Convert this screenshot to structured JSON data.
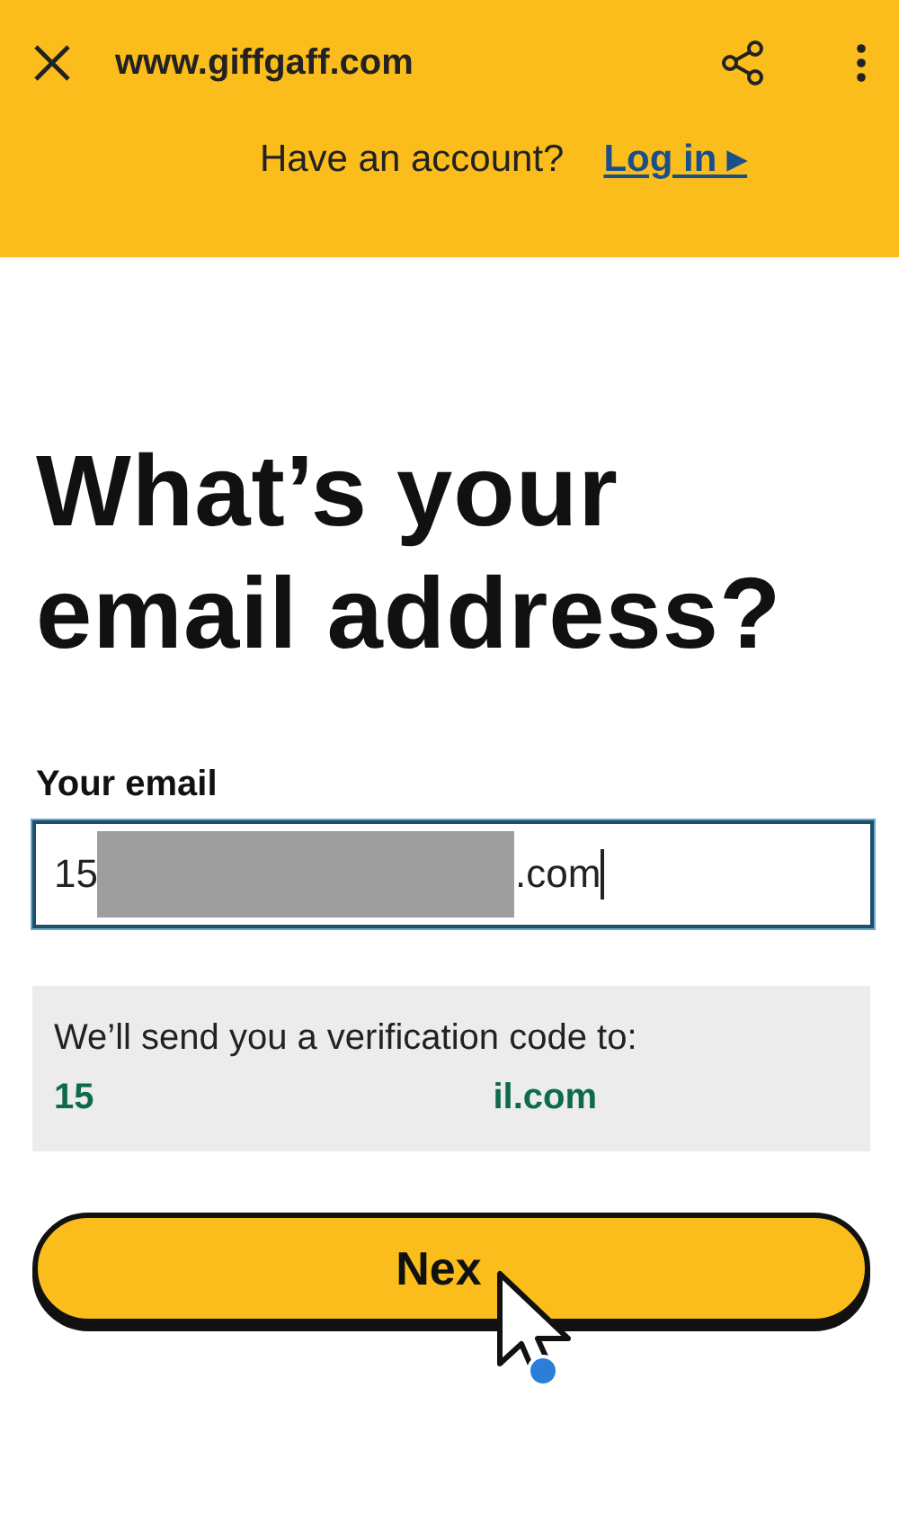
{
  "browser_bar": {
    "url": "www.giffgaff.com"
  },
  "account_prompt": {
    "text": "Have an account?",
    "link": "Log in ▸"
  },
  "heading": "What’s your email address?",
  "email_field": {
    "label": "Your email",
    "value_start": "15",
    "value_end": ".com",
    "redacted": true
  },
  "verification": {
    "text": "We’ll send you a verification code to:",
    "email_start": "15",
    "email_end": "il.com"
  },
  "next_button": {
    "label": "Nex"
  }
}
